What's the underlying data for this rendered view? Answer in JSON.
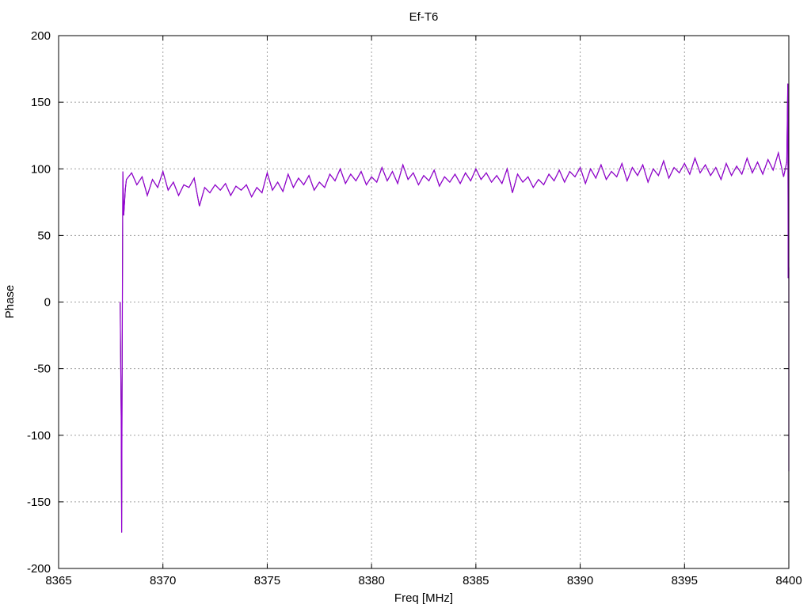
{
  "chart_data": {
    "type": "line",
    "title": "Ef-T6",
    "xlabel": "Freq [MHz]",
    "ylabel": "Phase",
    "xlim": [
      8365,
      8400
    ],
    "ylim": [
      -200,
      200
    ],
    "xticks": [
      8365,
      8370,
      8375,
      8380,
      8385,
      8390,
      8395,
      8400
    ],
    "yticks": [
      -200,
      -150,
      -100,
      -50,
      0,
      50,
      100,
      150,
      200
    ],
    "grid": true,
    "legend": "none",
    "series": [
      {
        "name": "Ef-T6",
        "color": "#9400d3",
        "points": [
          [
            8367.95,
            0
          ],
          [
            8368.0,
            -86
          ],
          [
            8368.02,
            -173
          ],
          [
            8368.05,
            -37
          ],
          [
            8368.08,
            98
          ],
          [
            8368.12,
            65
          ],
          [
            8368.2,
            85
          ],
          [
            8368.25,
            92
          ],
          [
            8368.5,
            97
          ],
          [
            8368.75,
            88
          ],
          [
            8369,
            94
          ],
          [
            8369.25,
            80
          ],
          [
            8369.5,
            92
          ],
          [
            8369.75,
            86
          ],
          [
            8370,
            98
          ],
          [
            8370.25,
            84
          ],
          [
            8370.5,
            90
          ],
          [
            8370.75,
            80
          ],
          [
            8371,
            88
          ],
          [
            8371.25,
            86
          ],
          [
            8371.5,
            93
          ],
          [
            8371.75,
            72
          ],
          [
            8372,
            86
          ],
          [
            8372.25,
            82
          ],
          [
            8372.5,
            88
          ],
          [
            8372.75,
            84
          ],
          [
            8373,
            89
          ],
          [
            8373.25,
            80
          ],
          [
            8373.5,
            87
          ],
          [
            8373.75,
            84
          ],
          [
            8374,
            88
          ],
          [
            8374.25,
            79
          ],
          [
            8374.5,
            86
          ],
          [
            8374.75,
            82
          ],
          [
            8375,
            97
          ],
          [
            8375.25,
            84
          ],
          [
            8375.5,
            90
          ],
          [
            8375.75,
            83
          ],
          [
            8376,
            96
          ],
          [
            8376.25,
            86
          ],
          [
            8376.5,
            93
          ],
          [
            8376.75,
            88
          ],
          [
            8377,
            95
          ],
          [
            8377.25,
            84
          ],
          [
            8377.5,
            90
          ],
          [
            8377.75,
            86
          ],
          [
            8378,
            96
          ],
          [
            8378.25,
            91
          ],
          [
            8378.5,
            100
          ],
          [
            8378.75,
            89
          ],
          [
            8379,
            96
          ],
          [
            8379.25,
            91
          ],
          [
            8379.5,
            98
          ],
          [
            8379.75,
            88
          ],
          [
            8380,
            94
          ],
          [
            8380.25,
            90
          ],
          [
            8380.5,
            101
          ],
          [
            8380.75,
            91
          ],
          [
            8381,
            98
          ],
          [
            8381.25,
            89
          ],
          [
            8381.5,
            103
          ],
          [
            8381.75,
            92
          ],
          [
            8382,
            97
          ],
          [
            8382.25,
            88
          ],
          [
            8382.5,
            95
          ],
          [
            8382.75,
            91
          ],
          [
            8383,
            99
          ],
          [
            8383.25,
            87
          ],
          [
            8383.5,
            94
          ],
          [
            8383.75,
            90
          ],
          [
            8384,
            96
          ],
          [
            8384.25,
            89
          ],
          [
            8384.5,
            97
          ],
          [
            8384.75,
            91
          ],
          [
            8385,
            100
          ],
          [
            8385.25,
            92
          ],
          [
            8385.5,
            97
          ],
          [
            8385.75,
            90
          ],
          [
            8386,
            95
          ],
          [
            8386.25,
            89
          ],
          [
            8386.5,
            100
          ],
          [
            8386.75,
            82
          ],
          [
            8387,
            96
          ],
          [
            8387.25,
            90
          ],
          [
            8387.5,
            94
          ],
          [
            8387.75,
            86
          ],
          [
            8388,
            92
          ],
          [
            8388.25,
            88
          ],
          [
            8388.5,
            96
          ],
          [
            8388.75,
            91
          ],
          [
            8389,
            99
          ],
          [
            8389.25,
            90
          ],
          [
            8389.5,
            98
          ],
          [
            8389.75,
            94
          ],
          [
            8390,
            101
          ],
          [
            8390.25,
            89
          ],
          [
            8390.5,
            100
          ],
          [
            8390.75,
            93
          ],
          [
            8391,
            103
          ],
          [
            8391.25,
            92
          ],
          [
            8391.5,
            98
          ],
          [
            8391.75,
            94
          ],
          [
            8392,
            104
          ],
          [
            8392.25,
            91
          ],
          [
            8392.5,
            101
          ],
          [
            8392.75,
            95
          ],
          [
            8393,
            103
          ],
          [
            8393.25,
            90
          ],
          [
            8393.5,
            100
          ],
          [
            8393.75,
            95
          ],
          [
            8394,
            106
          ],
          [
            8394.25,
            93
          ],
          [
            8394.5,
            101
          ],
          [
            8394.75,
            97
          ],
          [
            8395,
            104
          ],
          [
            8395.25,
            96
          ],
          [
            8395.5,
            108
          ],
          [
            8395.75,
            97
          ],
          [
            8396,
            103
          ],
          [
            8396.25,
            95
          ],
          [
            8396.5,
            101
          ],
          [
            8396.75,
            92
          ],
          [
            8397,
            104
          ],
          [
            8397.25,
            95
          ],
          [
            8397.5,
            102
          ],
          [
            8397.75,
            96
          ],
          [
            8398,
            108
          ],
          [
            8398.25,
            97
          ],
          [
            8398.5,
            105
          ],
          [
            8398.75,
            96
          ],
          [
            8399,
            107
          ],
          [
            8399.25,
            99
          ],
          [
            8399.5,
            112
          ],
          [
            8399.75,
            94
          ],
          [
            8399.9,
            105
          ],
          [
            8399.95,
            164
          ],
          [
            8399.97,
            18
          ],
          [
            8400,
            26
          ],
          [
            8400,
            -127
          ]
        ]
      }
    ]
  }
}
